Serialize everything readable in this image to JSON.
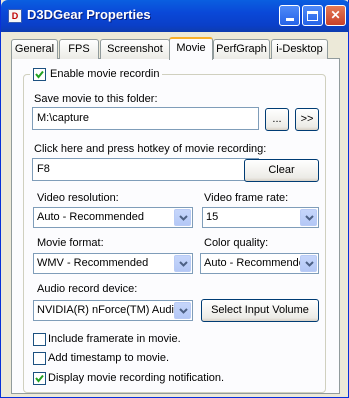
{
  "window": {
    "title": "D3DGear Properties"
  },
  "tabs": [
    {
      "label": "General"
    },
    {
      "label": "FPS"
    },
    {
      "label": "Screenshot"
    },
    {
      "label": "Movie",
      "active": true
    },
    {
      "label": "PerfGraph"
    },
    {
      "label": "i-Desktop"
    }
  ],
  "movie": {
    "enable_label": "Enable movie recordin",
    "enable_checked": true,
    "folder_label": "Save movie to this folder:",
    "folder_value": "M:\\capture",
    "browse_label": "...",
    "open_label": ">>",
    "hotkey_label": "Click here and press hotkey of movie recording:",
    "hotkey_value": "F8",
    "clear_label": "Clear",
    "resolution_label": "Video resolution:",
    "resolution_value": "Auto - Recommended",
    "framerate_label": "Video frame rate:",
    "framerate_value": "15",
    "format_label": "Movie format:",
    "format_value": "WMV - Recommended",
    "quality_label": "Color quality:",
    "quality_value": "Auto - Recommende",
    "audio_label": "Audio record device:",
    "audio_value": "NVIDIA(R) nForce(TM) Audio",
    "input_volume_label": "Select Input Volume",
    "framerate_check_label": "Include framerate in movie.",
    "framerate_check_checked": false,
    "timestamp_check_label": "Add timestamp to movie.",
    "timestamp_check_checked": false,
    "notification_check_label": "Display movie recording notification.",
    "notification_check_checked": true
  }
}
